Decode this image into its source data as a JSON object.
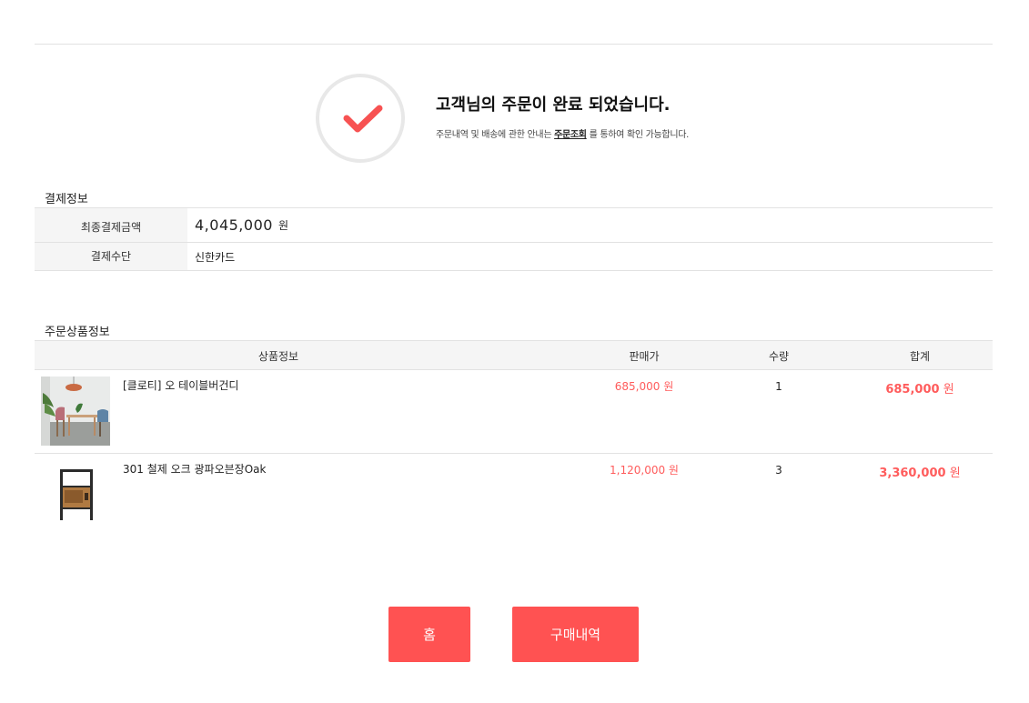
{
  "complete": {
    "title": "고객님의 주문이 완료 되었습니다.",
    "desc_before": "주문내역 및 배송에 관한 안내는 ",
    "desc_link": "주문조회",
    "desc_after": " 를 통하여 확인 가능합니다."
  },
  "payment": {
    "section_title": "결제정보",
    "amount_label": "최종결제금액",
    "amount_value": "4,045,000",
    "amount_unit": "원",
    "method_label": "결제수단",
    "method_value": "신한카드"
  },
  "order": {
    "section_title": "주문상품정보",
    "columns": [
      "상품정보",
      "판매가",
      "수량",
      "합계"
    ],
    "items": [
      {
        "name": "[클로티] 오 테이블버건디",
        "price": "685,000 원",
        "qty": "1",
        "total_value": "685,000",
        "total_unit": "원"
      },
      {
        "name": "301 철제 오크 광파오븐장Oak",
        "price": "1,120,000 원",
        "qty": "3",
        "total_value": "3,360,000",
        "total_unit": "원"
      }
    ]
  },
  "buttons": {
    "home": "홈",
    "history": "구매내역"
  },
  "colors": {
    "accent": "#ff5252",
    "price_red": "#ff5c5c",
    "check_red": "#f75252"
  }
}
